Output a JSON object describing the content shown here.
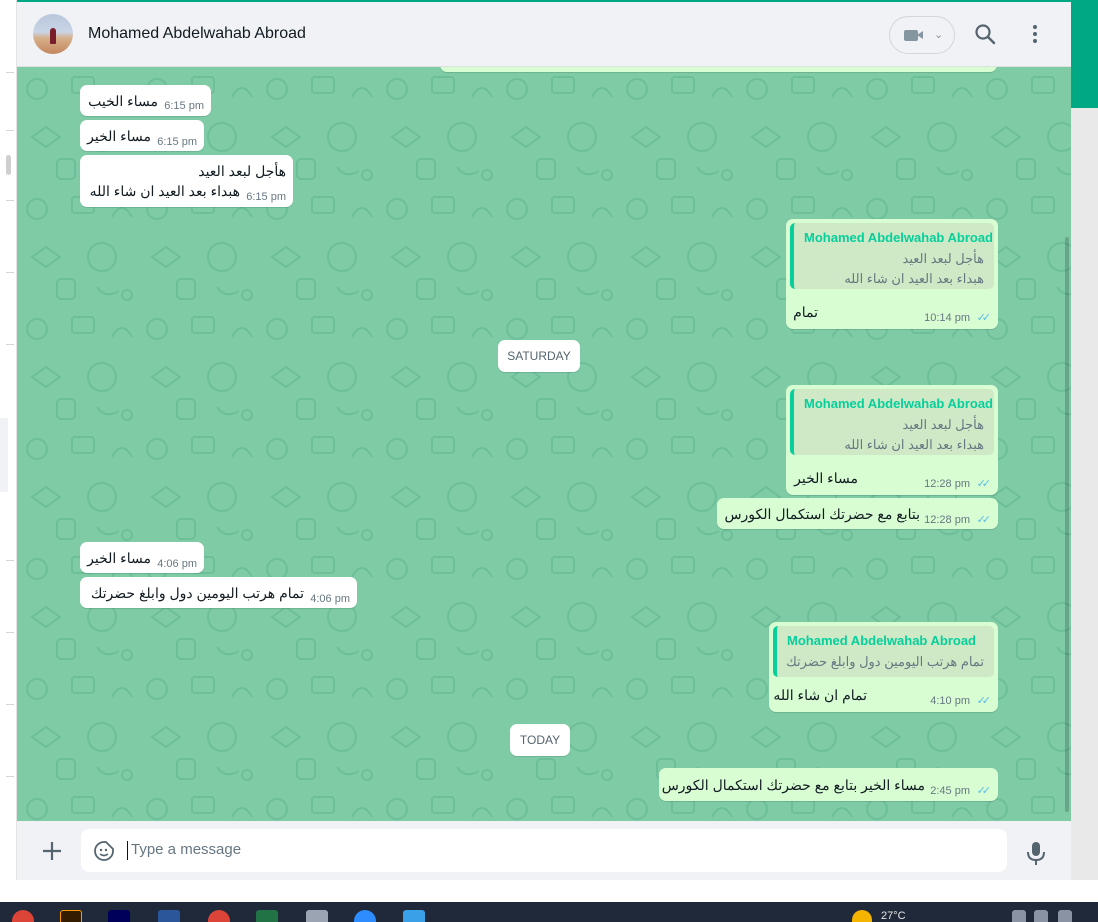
{
  "header": {
    "contact_name": "Mohamed Abdelwahab Abroad"
  },
  "icons": {
    "video": "video-camera-icon",
    "search": "search-icon",
    "menu": "kebab-menu-icon",
    "plus": "plus-icon",
    "sticker": "sticker-icon",
    "mic": "microphone-icon"
  },
  "colors": {
    "header_bg": "#f0f2f5",
    "chat_bg": "#7ecba6",
    "incoming_bubble": "#ffffff",
    "outgoing_bubble": "#d9fdd3",
    "accent": "#00a884",
    "quote_name": "#06cf9c",
    "read_ticks": "#53bdeb",
    "taskbar": "#20293a"
  },
  "messages": [
    {
      "dir": "in",
      "text": "مساء الخيب",
      "time": "6:15 pm"
    },
    {
      "dir": "in",
      "text": "مساء الخير",
      "time": "6:15 pm"
    },
    {
      "dir": "in",
      "lines": [
        "هأجل لبعد العيد",
        "هبداء بعد العيد ان شاء الله"
      ],
      "time": "6:15 pm"
    },
    {
      "dir": "out",
      "quote": {
        "name": "Mohamed Abdelwahab Abroad",
        "lines": [
          "هأجل لبعد العيد",
          "هبداء بعد العيد ان شاء الله"
        ]
      },
      "text": "تمام",
      "time": "10:14 pm",
      "status": "read"
    },
    {
      "dir": "out",
      "quote": {
        "name": "Mohamed Abdelwahab Abroad",
        "lines": [
          "هأجل لبعد العيد",
          "هبداء بعد العيد ان شاء الله"
        ]
      },
      "text": "مساء الخير",
      "time": "12:28 pm",
      "status": "read"
    },
    {
      "dir": "out",
      "text": "بتابع مع حضرتك استكمال الكورس",
      "time": "12:28 pm",
      "status": "read"
    },
    {
      "dir": "in",
      "text": "مساء الخير",
      "time": "4:06 pm"
    },
    {
      "dir": "in",
      "text": "تمام هرتب اليومين دول وابلغ حضرتك",
      "time": "4:06 pm"
    },
    {
      "dir": "out",
      "quote": {
        "name": "Mohamed Abdelwahab Abroad",
        "lines": [
          "تمام هرتب اليومين دول وابلغ حضرتك"
        ]
      },
      "text": "تمام ان شاء الله",
      "time": "4:10 pm",
      "status": "read"
    },
    {
      "dir": "out",
      "text": "مساء الخير بتابع مع حضرتك استكمال الكورس",
      "time": "2:45 pm",
      "status": "read"
    }
  ],
  "dividers": {
    "saturday": "SATURDAY",
    "today": "TODAY"
  },
  "composer": {
    "placeholder": "Type a message"
  },
  "taskbar": {
    "temperature": "27°C"
  }
}
